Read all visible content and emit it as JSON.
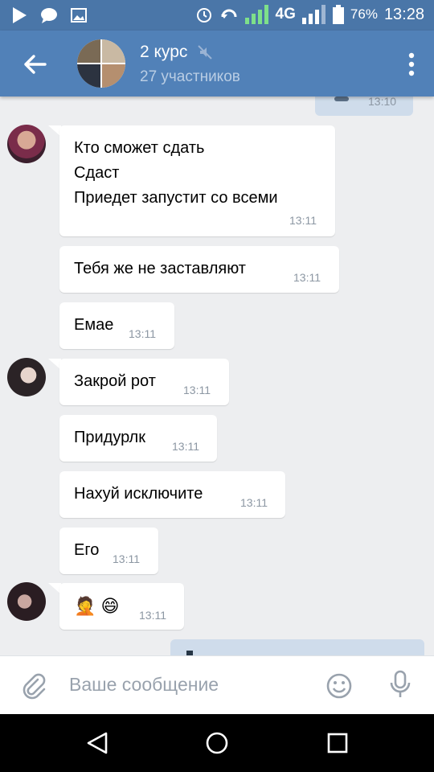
{
  "status_bar": {
    "battery": "76%",
    "time": "13:28",
    "network": "4G"
  },
  "header": {
    "title": "2 курс",
    "subtitle": "27 участников"
  },
  "messages": [
    {
      "text": "",
      "time": "13:10",
      "outgoing": true
    },
    {
      "text": "Кто сможет сдать\nСдаст\nПриедет запустит со всеми",
      "time": "13:11"
    },
    {
      "text": "Тебя же не заставляют",
      "time": "13:11"
    },
    {
      "text": "Емае",
      "time": "13:11"
    },
    {
      "text": "Закрой рот",
      "time": "13:11"
    },
    {
      "text": "Придурлк",
      "time": "13:11"
    },
    {
      "text": "Нахуй исключите",
      "time": "13:11"
    },
    {
      "text": "Его",
      "time": "13:11"
    },
    {
      "text": "🤦 😄",
      "time": "13:11"
    }
  ],
  "composer": {
    "placeholder": "Ваше сообщение"
  },
  "colors": {
    "header": "#5181b8",
    "status_bar": "#4a76a8",
    "background": "#edeef0",
    "outgoing_bubble": "#cfdceb"
  }
}
